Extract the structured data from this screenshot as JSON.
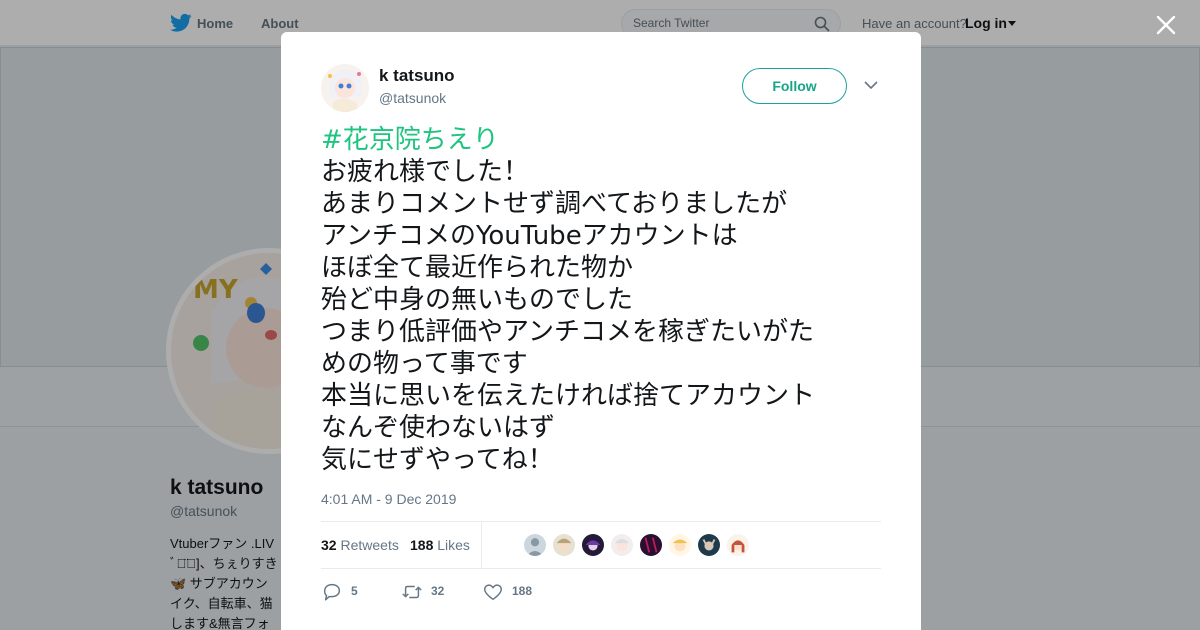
{
  "nav": {
    "home_label": "Home",
    "about_label": "About",
    "search_placeholder": "Search Twitter",
    "have_account": "Have an account?",
    "login_label": "Log in"
  },
  "profile": {
    "name": "k tatsuno",
    "handle": "@tatsunok",
    "bio_lines": [
      "Vtuberファン .LIV",
      "ﾞ◡̈ﾞ]、ちぇりすき",
      "🦋 サブアカウン",
      "イク、自転車、猫",
      "します&無言フォ"
    ]
  },
  "tweet": {
    "author_name": "k tatsuno",
    "author_handle": "@tatsunok",
    "follow_label": "Follow",
    "hashtag": "#花京院ちえり",
    "lines": [
      "お疲れ様でした！",
      "あまりコメントせず調べておりましたが",
      "アンチコメのYouTubeアカウントは",
      "ほぼ全て最近作られた物か",
      "殆ど中身の無いものでした",
      "つまり低評価やアンチコメを稼ぎたいがた",
      "めの物って事です",
      "本当に思いを伝えたければ捨てアカウント",
      "なんぞ使わないはず",
      "気にせずやってね！"
    ],
    "timestamp": "4:01 AM - 9 Dec 2019",
    "stats": {
      "retweets_count": "32",
      "retweets_label": "Retweets",
      "likes_count": "188",
      "likes_label": "Likes"
    },
    "actions": {
      "replies": "5",
      "retweets": "32",
      "likes": "188"
    }
  },
  "colors": {
    "accent": "#1da1f2",
    "hashtag": "#1ec47f",
    "follow_border": "#1da1a0",
    "muted": "#657786"
  }
}
